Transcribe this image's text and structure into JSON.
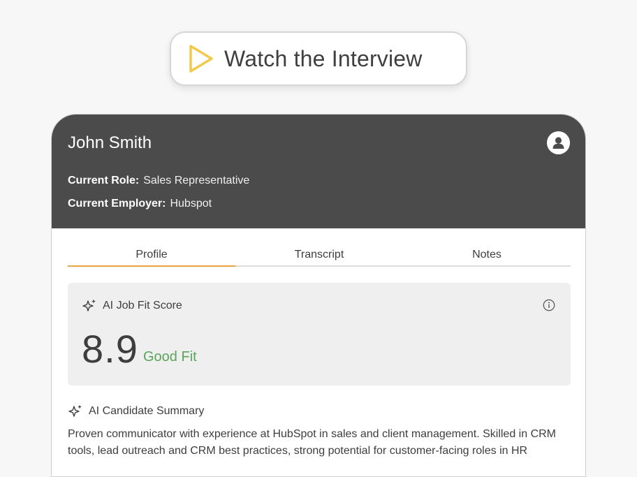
{
  "watch_button": {
    "label": "Watch the Interview",
    "icon": "play-icon",
    "icon_color": "#f2c94c"
  },
  "candidate": {
    "name": "John Smith",
    "role_label": "Current Role:",
    "role": "Sales Representative",
    "employer_label": "Current Employer:",
    "employer": "Hubspot",
    "avatar_icon": "user-avatar-icon"
  },
  "tabs": [
    {
      "label": "Profile",
      "active": true
    },
    {
      "label": "Transcript",
      "active": false
    },
    {
      "label": "Notes",
      "active": false
    }
  ],
  "score": {
    "title": "AI Job Fit Score",
    "value": "8.9",
    "label": "Good Fit",
    "label_color": "#5aa55a",
    "info_icon": "info-icon"
  },
  "summary": {
    "title": "AI Candidate Summary",
    "text": "Proven communicator with experience at HubSpot in sales and client management. Skilled in CRM tools, lead outreach and CRM best practices, strong potential for customer-facing roles in HR"
  },
  "colors": {
    "header_bg": "#4a4b4a",
    "accent_tab": "#e8a33b"
  }
}
